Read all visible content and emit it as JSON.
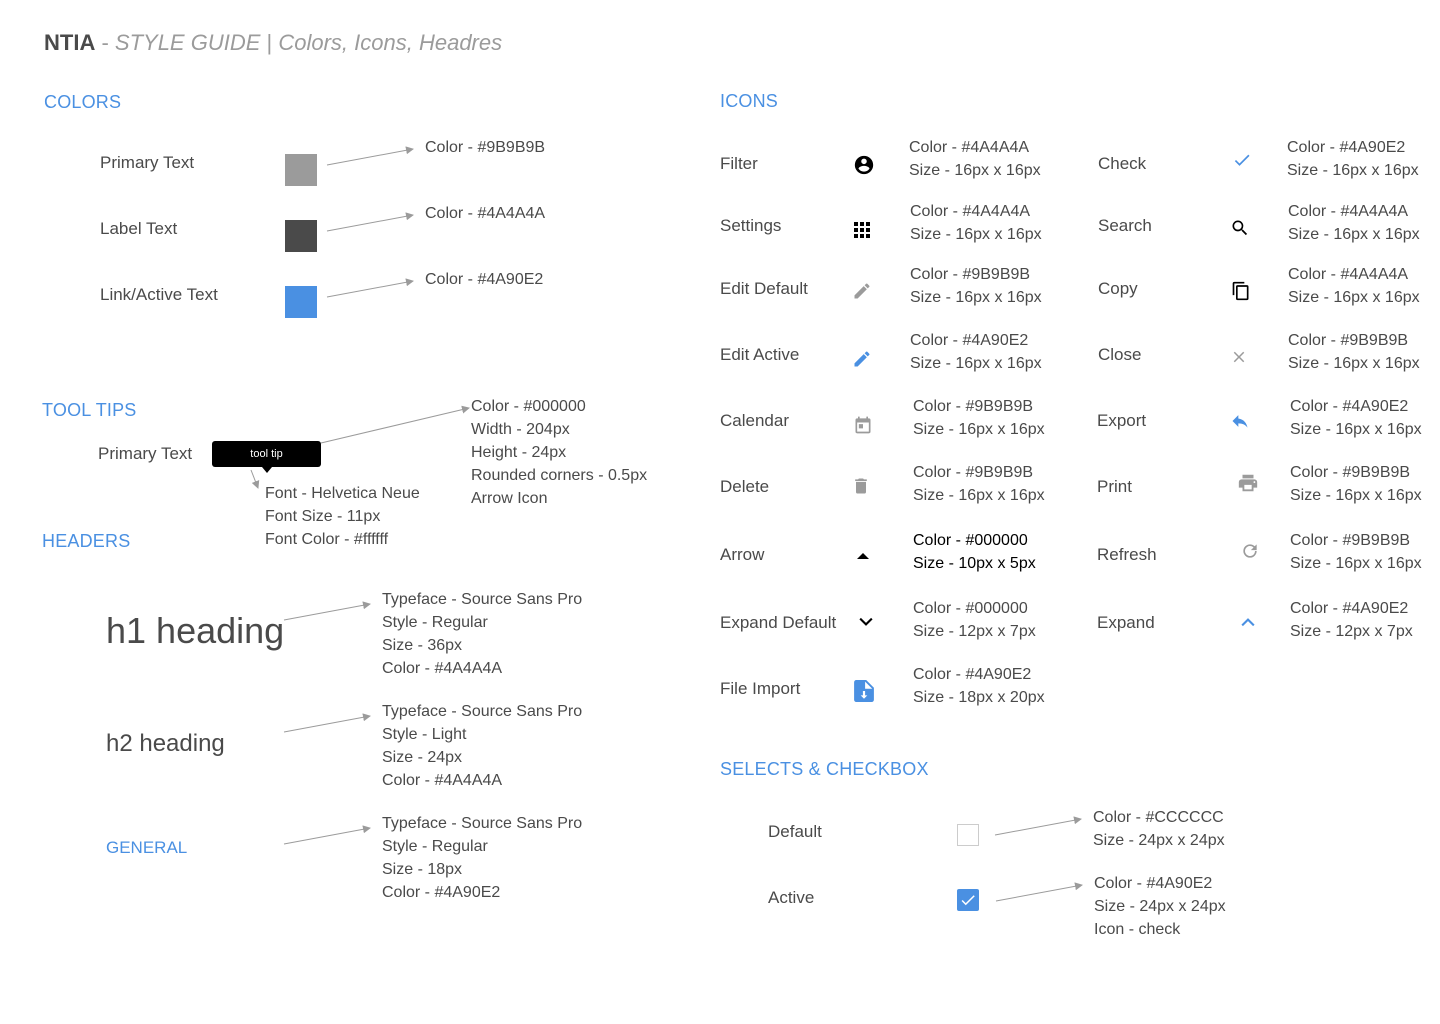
{
  "header": {
    "brand": "NTIA",
    "dash": "-",
    "subtitle": "STYLE GUIDE",
    "separator": "|",
    "topics": "Colors, Icons, Headres"
  },
  "colors_section": {
    "title": "COLORS",
    "items": [
      {
        "label": "Primary Text",
        "spec": "Color - #9B9B9B",
        "hex": "#9B9B9B"
      },
      {
        "label": "Label Text",
        "spec": "Color - #4A4A4A",
        "hex": "#4A4A4A"
      },
      {
        "label": "Link/Active Text",
        "spec": "Color - #4A90E2",
        "hex": "#4A90E2"
      }
    ]
  },
  "tooltips_section": {
    "title": "TOOL TIPS",
    "label": "Primary Text",
    "tip_text": "tool tip",
    "box_spec": [
      "Color - #000000",
      "Width - 204px",
      "Height - 24px",
      "Rounded corners - 0.5px",
      "Arrow Icon"
    ],
    "font_spec": [
      "Font - Helvetica Neue",
      "Font Size - 11px",
      "Font Color - #ffffff"
    ]
  },
  "headers_section": {
    "title": "HEADERS",
    "items": [
      {
        "demo": "h1 heading",
        "spec": [
          "Typeface - Source Sans Pro",
          "Style - Regular",
          "Size - 36px",
          "Color - #4A4A4A"
        ]
      },
      {
        "demo": "h2 heading",
        "spec": [
          "Typeface - Source Sans Pro",
          "Style - Light",
          "Size - 24px",
          "Color - #4A4A4A"
        ]
      },
      {
        "demo": "GENERAL",
        "spec": [
          "Typeface - Source Sans Pro",
          "Style - Regular",
          "Size - 18px",
          "Color - #4A90E2"
        ]
      }
    ]
  },
  "icons_section": {
    "title": "ICONS",
    "left": [
      {
        "label": "Filter",
        "icon": "account-circle-icon",
        "color": "#000000",
        "spec": [
          "Color - #4A4A4A",
          "Size - 16px x 16px"
        ]
      },
      {
        "label": "Settings",
        "icon": "apps-grid-icon",
        "color": "#000000",
        "spec": [
          "Color - #4A4A4A",
          "Size - 16px x 16px"
        ]
      },
      {
        "label": "Edit Default",
        "icon": "pencil-icon",
        "color": "#9B9B9B",
        "spec": [
          "Color - #9B9B9B",
          "Size - 16px x 16px"
        ]
      },
      {
        "label": "Edit Active",
        "icon": "pencil-icon",
        "color": "#4A90E2",
        "spec": [
          "Color - #4A90E2",
          "Size - 16px x 16px"
        ]
      },
      {
        "label": "Calendar",
        "icon": "calendar-icon",
        "color": "#9B9B9B",
        "spec": [
          "Color - #9B9B9B",
          "Size - 16px x 16px"
        ]
      },
      {
        "label": "Delete",
        "icon": "trash-icon",
        "color": "#9B9B9B",
        "spec": [
          "Color - #9B9B9B",
          "Size - 16px x 16px"
        ]
      },
      {
        "label": "Arrow",
        "icon": "caret-up-icon",
        "color": "#000000",
        "spec": [
          "Color - #000000",
          "Size - 10px x 5px"
        ]
      },
      {
        "label": "Expand Default",
        "icon": "chevron-down-icon",
        "color": "#000000",
        "spec": [
          "Color - #000000",
          "Size - 12px x 7px"
        ]
      },
      {
        "label": "File Import",
        "icon": "file-import-icon",
        "color": "#4A90E2",
        "spec": [
          "Color - #4A90E2",
          "Size - 18px x 20px"
        ]
      }
    ],
    "right": [
      {
        "label": "Check",
        "icon": "check-icon",
        "color": "#4A90E2",
        "spec": [
          "Color - #4A90E2",
          "Size - 16px x 16px"
        ]
      },
      {
        "label": "Search",
        "icon": "search-icon",
        "color": "#000000",
        "spec": [
          "Color - #4A4A4A",
          "Size - 16px x 16px"
        ]
      },
      {
        "label": "Copy",
        "icon": "copy-icon",
        "color": "#000000",
        "spec": [
          "Color - #4A4A4A",
          "Size - 16px x 16px"
        ]
      },
      {
        "label": "Close",
        "icon": "close-icon",
        "color": "#9B9B9B",
        "spec": [
          "Color - #9B9B9B",
          "Size - 16px x 16px"
        ]
      },
      {
        "label": "Export",
        "icon": "reply-icon",
        "color": "#4A90E2",
        "spec": [
          "Color - #4A90E2",
          "Size - 16px x 16px"
        ]
      },
      {
        "label": "Print",
        "icon": "printer-icon",
        "color": "#9B9B9B",
        "spec": [
          "Color - #9B9B9B",
          "Size - 16px x 16px"
        ]
      },
      {
        "label": "Refresh",
        "icon": "refresh-icon",
        "color": "#9B9B9B",
        "spec": [
          "Color - #9B9B9B",
          "Size - 16px x 16px"
        ]
      },
      {
        "label": "Expand",
        "icon": "chevron-up-icon",
        "color": "#4A90E2",
        "spec": [
          "Color - #4A90E2",
          "Size - 12px x 7px"
        ]
      }
    ]
  },
  "selects_section": {
    "title": "SELECTS & CHECKBOX",
    "items": [
      {
        "label": "Default",
        "spec": [
          "Color - #CCCCCC",
          "Size - 24px x 24px"
        ],
        "checked": false
      },
      {
        "label": "Active",
        "spec": [
          "Color - #4A90E2",
          "Size - 24px x 24px",
          "Icon - check"
        ],
        "checked": true
      }
    ]
  }
}
